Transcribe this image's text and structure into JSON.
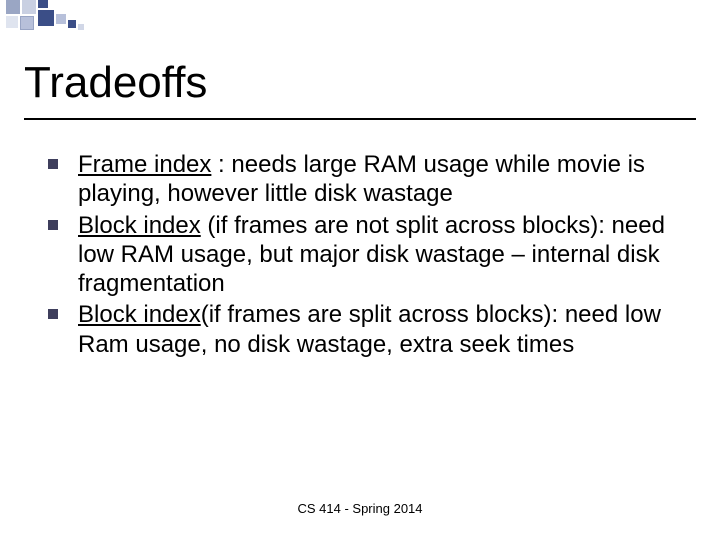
{
  "title": "Tradeoffs",
  "bullets": [
    {
      "lead": "Frame index",
      "rest": " : needs large RAM usage while movie is playing, however little disk wastage"
    },
    {
      "lead": "Block index",
      "rest": " (if frames are not split across blocks): need low RAM usage, but major disk wastage – internal disk fragmentation"
    },
    {
      "lead": "Block index",
      "rest": "(if frames are split across blocks): need low Ram usage, no disk wastage, extra seek times"
    }
  ],
  "footer": "CS 414 - Spring 2014"
}
